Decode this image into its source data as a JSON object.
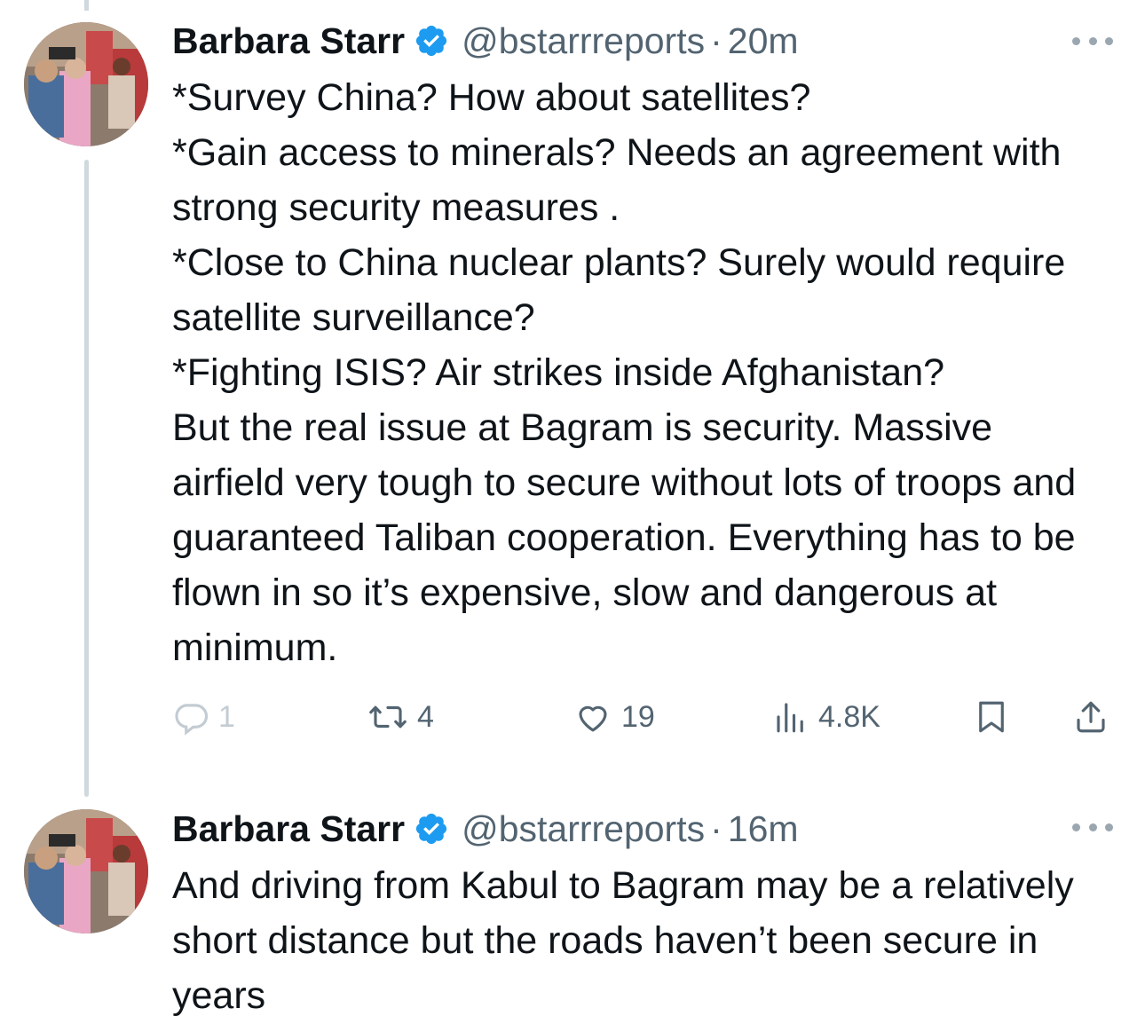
{
  "tweets": [
    {
      "author_name": "Barbara Starr",
      "handle": "@bstarrreports",
      "separator": "·",
      "time": "20m",
      "text": "*Survey China? How about satellites?\n*Gain access to minerals? Needs an agreement with strong security measures .\n*Close to China nuclear plants? Surely would require satellite surveillance?\n*Fighting ISIS? Air strikes inside Afghanistan?\nBut the real issue at Bagram is security. Massive airfield very tough to secure without lots of troops and guaranteed Taliban cooperation. Everything has to be flown in so it’s expensive, slow and dangerous at minimum.",
      "replies": "1",
      "reposts": "4",
      "likes": "19",
      "views": "4.8K"
    },
    {
      "author_name": "Barbara Starr",
      "handle": "@bstarrreports",
      "separator": "·",
      "time": "16m",
      "text": "And driving from Kabul to Bagram may be a relatively short distance but the roads haven’t been secure in years"
    }
  ],
  "colors": {
    "text": "#0f1419",
    "secondary": "#536471",
    "verified_blue": "#1d9bf0",
    "thread_line": "#cfd9de"
  },
  "icons": [
    "verified-badge-icon",
    "more-icon",
    "reply-icon",
    "repost-icon",
    "like-icon",
    "views-icon",
    "bookmark-icon",
    "share-icon"
  ]
}
